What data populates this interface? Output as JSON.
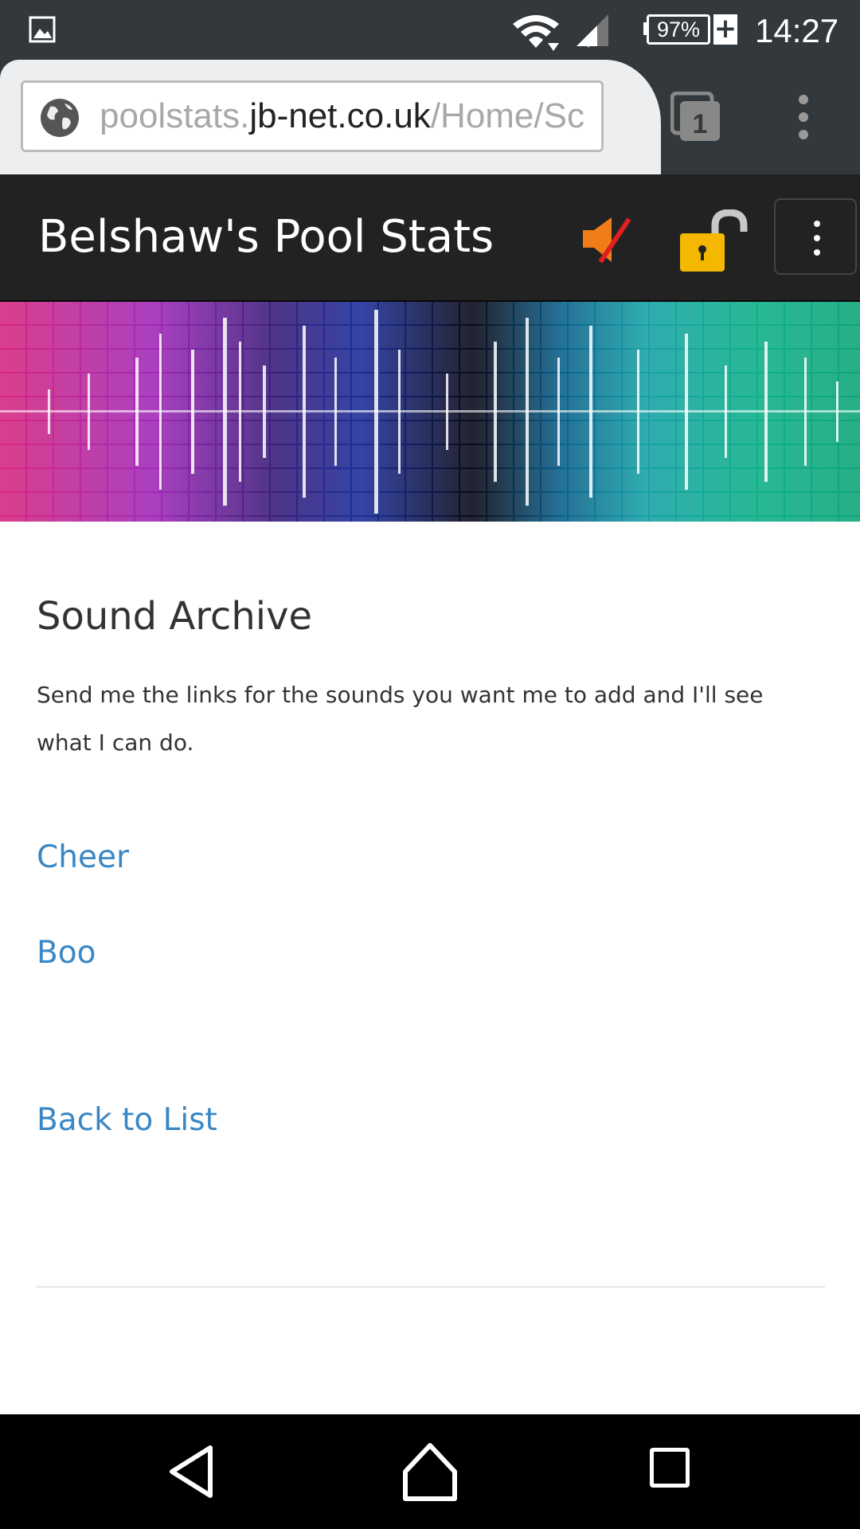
{
  "status_bar": {
    "battery_percent": "97%",
    "charging_symbol": "+",
    "time": "14:27",
    "icons": [
      "gallery-icon",
      "wifi-icon",
      "signal-icon",
      "battery-icon"
    ]
  },
  "browser": {
    "url_prefix": "poolstats.",
    "url_domain": "jb-net.co.uk",
    "url_path": "/Home/Sc",
    "tab_count": "1"
  },
  "app": {
    "brand": "Belshaw's Pool Stats",
    "icons": [
      "sound-muted-icon",
      "unlocked-padlock-icon",
      "menu-toggle-icon"
    ]
  },
  "page": {
    "title": "Sound Archive",
    "description": "Send me the links for the sounds you want me to add and I'll see what I can do.",
    "sounds": [
      {
        "label": "Cheer"
      },
      {
        "label": "Boo"
      }
    ],
    "back_link": "Back to List"
  },
  "colors": {
    "status_bar": "#33383c",
    "navbar": "#222222",
    "link": "#3a87c6",
    "text": "#333333"
  }
}
